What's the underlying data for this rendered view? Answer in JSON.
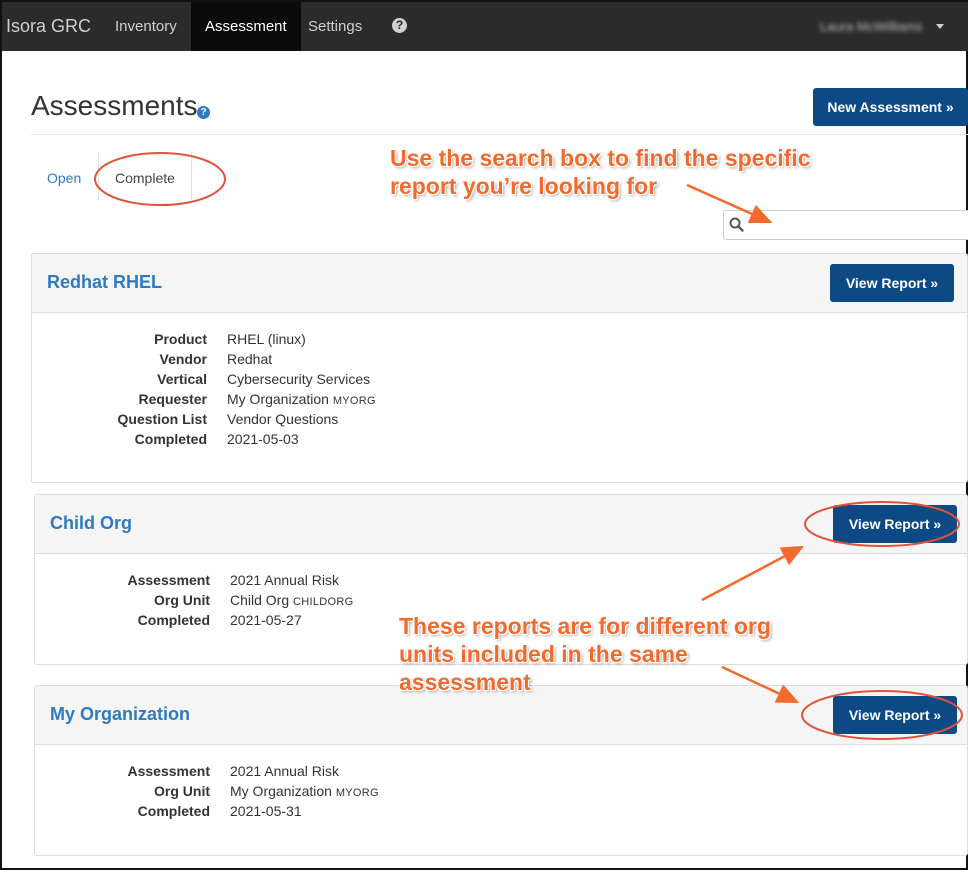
{
  "navbar": {
    "brand": "Isora GRC",
    "items": [
      {
        "label": "Inventory"
      },
      {
        "label": "Assessment"
      },
      {
        "label": "Settings"
      }
    ],
    "help_icon": "?",
    "user_name": "Laura McWilliams"
  },
  "header": {
    "title": "Assessments",
    "help_icon": "?",
    "new_button": "New Assessment »"
  },
  "tabs": [
    {
      "label": "Open"
    },
    {
      "label": "Complete"
    }
  ],
  "search": {
    "placeholder": ""
  },
  "reports": [
    {
      "title": "Redhat RHEL",
      "button": "View Report »",
      "fields": [
        {
          "label": "Product",
          "value": "RHEL (linux)",
          "tag": ""
        },
        {
          "label": "Vendor",
          "value": "Redhat",
          "tag": ""
        },
        {
          "label": "Vertical",
          "value": "Cybersecurity Services",
          "tag": ""
        },
        {
          "label": "Requester",
          "value": "My Organization",
          "tag": "MYORG"
        },
        {
          "label": "Question List",
          "value": "Vendor Questions",
          "tag": ""
        },
        {
          "label": "Completed",
          "value": "2021-05-03",
          "tag": ""
        }
      ]
    },
    {
      "title": "Child Org",
      "button": "View Report »",
      "fields": [
        {
          "label": "Assessment",
          "value": "2021 Annual Risk",
          "tag": ""
        },
        {
          "label": "Org Unit",
          "value": "Child Org",
          "tag": "CHILDORG"
        },
        {
          "label": "Completed",
          "value": "2021-05-27",
          "tag": ""
        }
      ]
    },
    {
      "title": "My Organization",
      "button": "View Report »",
      "fields": [
        {
          "label": "Assessment",
          "value": "2021 Annual Risk",
          "tag": ""
        },
        {
          "label": "Org Unit",
          "value": "My Organization",
          "tag": "MYORG"
        },
        {
          "label": "Completed",
          "value": "2021-05-31",
          "tag": ""
        }
      ]
    }
  ],
  "annotations": {
    "search_note": [
      "Use the search box to find the specific",
      "report you’re looking for"
    ],
    "reports_note": [
      "These reports are for different org",
      "units included in the same",
      "assessment"
    ],
    "color": "#f26a2c"
  }
}
